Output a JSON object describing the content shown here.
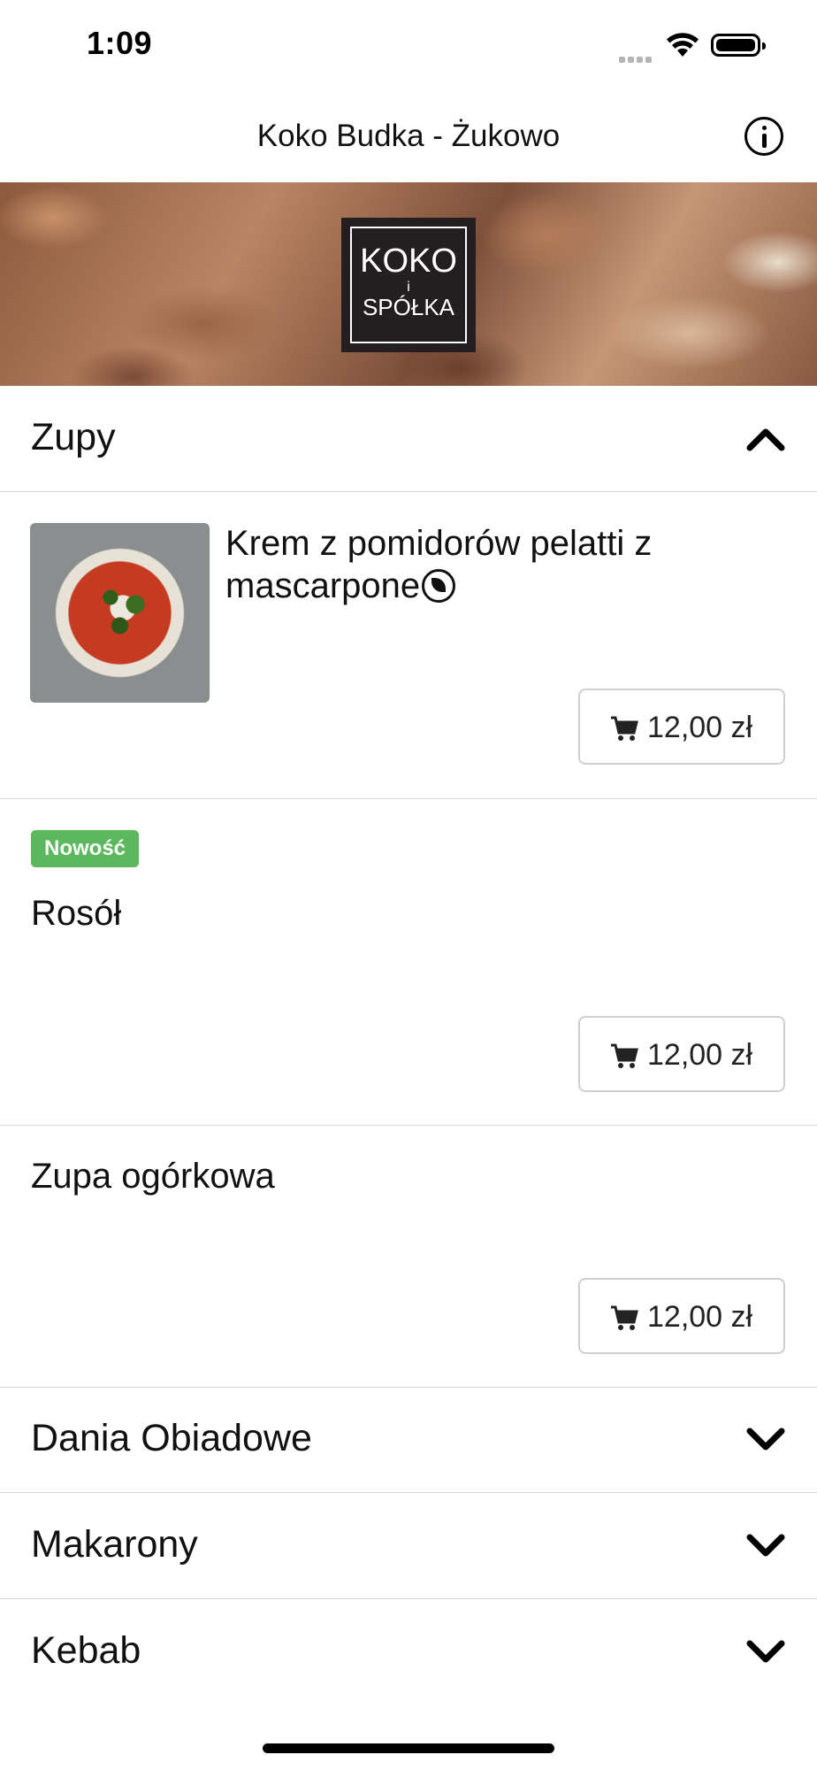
{
  "status": {
    "time": "1:09"
  },
  "nav": {
    "title": "Koko Budka - Żukowo",
    "info_icon": "info-icon"
  },
  "banner": {
    "logo_line1": "KOKO",
    "logo_line2": "i",
    "logo_line3": "SPÓŁKA",
    "logo_icons": "🍗🍕🥤🍔"
  },
  "sections": {
    "zupy": {
      "title": "Zupy",
      "expanded": true,
      "items": [
        {
          "name": "Krem z pomidorów pelatti z mascarpone",
          "price": "12,00 zł",
          "vegetarian": true,
          "has_image": true
        },
        {
          "badge": "Nowość",
          "name": "Rosół",
          "price": "12,00 zł"
        },
        {
          "name": "Zupa ogórkowa",
          "price": "12,00 zł"
        }
      ]
    },
    "dania": {
      "title": "Dania Obiadowe",
      "expanded": false
    },
    "makarony": {
      "title": "Makarony",
      "expanded": false
    },
    "kebab": {
      "title": "Kebab",
      "expanded": false
    }
  },
  "colors": {
    "badge_green": "#5cb85c",
    "divider": "#d9d9d9",
    "button_border": "#cfcfcf"
  }
}
